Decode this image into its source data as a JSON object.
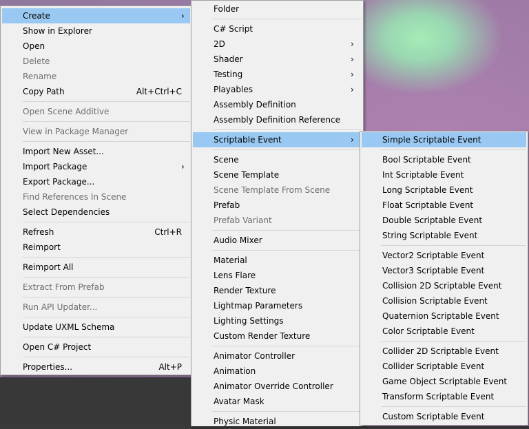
{
  "menu1": {
    "items": [
      {
        "label": "Create",
        "submenu": true,
        "highlighted": true
      },
      {
        "label": "Show in Explorer"
      },
      {
        "label": "Open"
      },
      {
        "label": "Delete",
        "disabled": true
      },
      {
        "label": "Rename",
        "disabled": true
      },
      {
        "label": "Copy Path",
        "shortcut": "Alt+Ctrl+C"
      },
      {
        "separator": true
      },
      {
        "label": "Open Scene Additive",
        "disabled": true
      },
      {
        "separator": true
      },
      {
        "label": "View in Package Manager",
        "disabled": true
      },
      {
        "separator": true
      },
      {
        "label": "Import New Asset..."
      },
      {
        "label": "Import Package",
        "submenu": true
      },
      {
        "label": "Export Package..."
      },
      {
        "label": "Find References In Scene",
        "disabled": true
      },
      {
        "label": "Select Dependencies"
      },
      {
        "separator": true
      },
      {
        "label": "Refresh",
        "shortcut": "Ctrl+R"
      },
      {
        "label": "Reimport"
      },
      {
        "separator": true
      },
      {
        "label": "Reimport All"
      },
      {
        "separator": true
      },
      {
        "label": "Extract From Prefab",
        "disabled": true
      },
      {
        "separator": true
      },
      {
        "label": "Run API Updater...",
        "disabled": true
      },
      {
        "separator": true
      },
      {
        "label": "Update UXML Schema"
      },
      {
        "separator": true
      },
      {
        "label": "Open C# Project"
      },
      {
        "separator": true
      },
      {
        "label": "Properties...",
        "shortcut": "Alt+P"
      }
    ]
  },
  "menu2": {
    "items": [
      {
        "label": "Folder"
      },
      {
        "separator": true
      },
      {
        "label": "C# Script"
      },
      {
        "label": "2D",
        "submenu": true
      },
      {
        "label": "Shader",
        "submenu": true
      },
      {
        "label": "Testing",
        "submenu": true
      },
      {
        "label": "Playables",
        "submenu": true
      },
      {
        "label": "Assembly Definition"
      },
      {
        "label": "Assembly Definition Reference"
      },
      {
        "separator": true
      },
      {
        "label": "Scriptable Event",
        "submenu": true,
        "highlighted": true
      },
      {
        "separator": true
      },
      {
        "label": "Scene"
      },
      {
        "label": "Scene Template"
      },
      {
        "label": "Scene Template From Scene",
        "disabled": true
      },
      {
        "label": "Prefab"
      },
      {
        "label": "Prefab Variant",
        "disabled": true
      },
      {
        "separator": true
      },
      {
        "label": "Audio Mixer"
      },
      {
        "separator": true
      },
      {
        "label": "Material"
      },
      {
        "label": "Lens Flare"
      },
      {
        "label": "Render Texture"
      },
      {
        "label": "Lightmap Parameters"
      },
      {
        "label": "Lighting Settings"
      },
      {
        "label": "Custom Render Texture"
      },
      {
        "separator": true
      },
      {
        "label": "Animator Controller"
      },
      {
        "label": "Animation"
      },
      {
        "label": "Animator Override Controller"
      },
      {
        "label": "Avatar Mask"
      },
      {
        "separator": true
      },
      {
        "label": "Physic Material"
      }
    ]
  },
  "menu3": {
    "items": [
      {
        "label": "Simple Scriptable Event",
        "highlighted": true
      },
      {
        "separator": true
      },
      {
        "label": "Bool Scriptable Event"
      },
      {
        "label": "Int Scriptable Event"
      },
      {
        "label": "Long Scriptable Event"
      },
      {
        "label": "Float Scriptable Event"
      },
      {
        "label": "Double Scriptable Event"
      },
      {
        "label": "String Scriptable Event"
      },
      {
        "separator": true
      },
      {
        "label": "Vector2 Scriptable Event"
      },
      {
        "label": "Vector3 Scriptable Event"
      },
      {
        "label": "Collision 2D Scriptable Event"
      },
      {
        "label": "Collision Scriptable Event"
      },
      {
        "label": "Quaternion Scriptable Event"
      },
      {
        "label": "Color Scriptable Event"
      },
      {
        "separator": true
      },
      {
        "label": "Collider 2D Scriptable Event"
      },
      {
        "label": "Collider Scriptable Event"
      },
      {
        "label": "Game Object Scriptable Event"
      },
      {
        "label": "Transform Scriptable Event"
      },
      {
        "separator": true
      },
      {
        "label": "Custom Scriptable Event"
      }
    ]
  },
  "icons": {
    "submenu_arrow": "chevron-right-icon",
    "arrow_glyph": "›"
  },
  "colors": {
    "menu_bg": "#f0f0f0",
    "highlight": "#99c9f2",
    "disabled_text": "#6d6d6d",
    "separator": "#d5d5d5"
  }
}
